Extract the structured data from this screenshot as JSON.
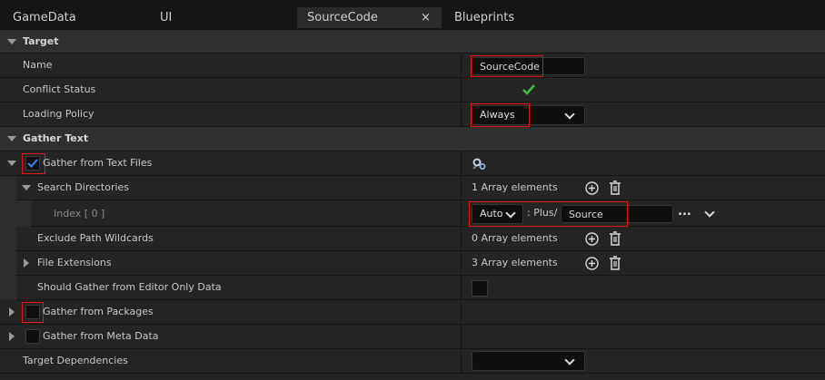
{
  "tabs": [
    {
      "label": "GameData"
    },
    {
      "label": "UI"
    },
    {
      "label": "SourceCode"
    },
    {
      "label": "Blueprints"
    }
  ],
  "tab_close_glyph": "×",
  "sections": {
    "target": {
      "header": "Target",
      "name_label": "Name",
      "name_value": "SourceCode",
      "conflict_label": "Conflict Status",
      "loading_label": "Loading Policy",
      "loading_value": "Always"
    },
    "gather_text": {
      "header": "Gather Text",
      "from_text_files_label": "Gather from Text Files",
      "from_text_files_checked": true,
      "search_dirs_label": "Search Directories",
      "search_dirs_value": "1 Array elements",
      "index_label": "Index [ 0 ]",
      "index_mode": "Auto",
      "index_prefix": ": Plus/",
      "index_path": "Source",
      "index_more": "...",
      "exclude_label": "Exclude Path Wildcards",
      "exclude_value": "0 Array elements",
      "extensions_label": "File Extensions",
      "extensions_value": "3 Array elements",
      "editor_only_label": "Should Gather from Editor Only Data",
      "from_packages_label": "Gather from Packages",
      "from_meta_label": "Gather from Meta Data",
      "target_deps_label": "Target Dependencies"
    }
  },
  "colors": {
    "highlight": "#e0161b",
    "check": "#2a8cff",
    "conflict_ok": "#3fbf3f"
  }
}
